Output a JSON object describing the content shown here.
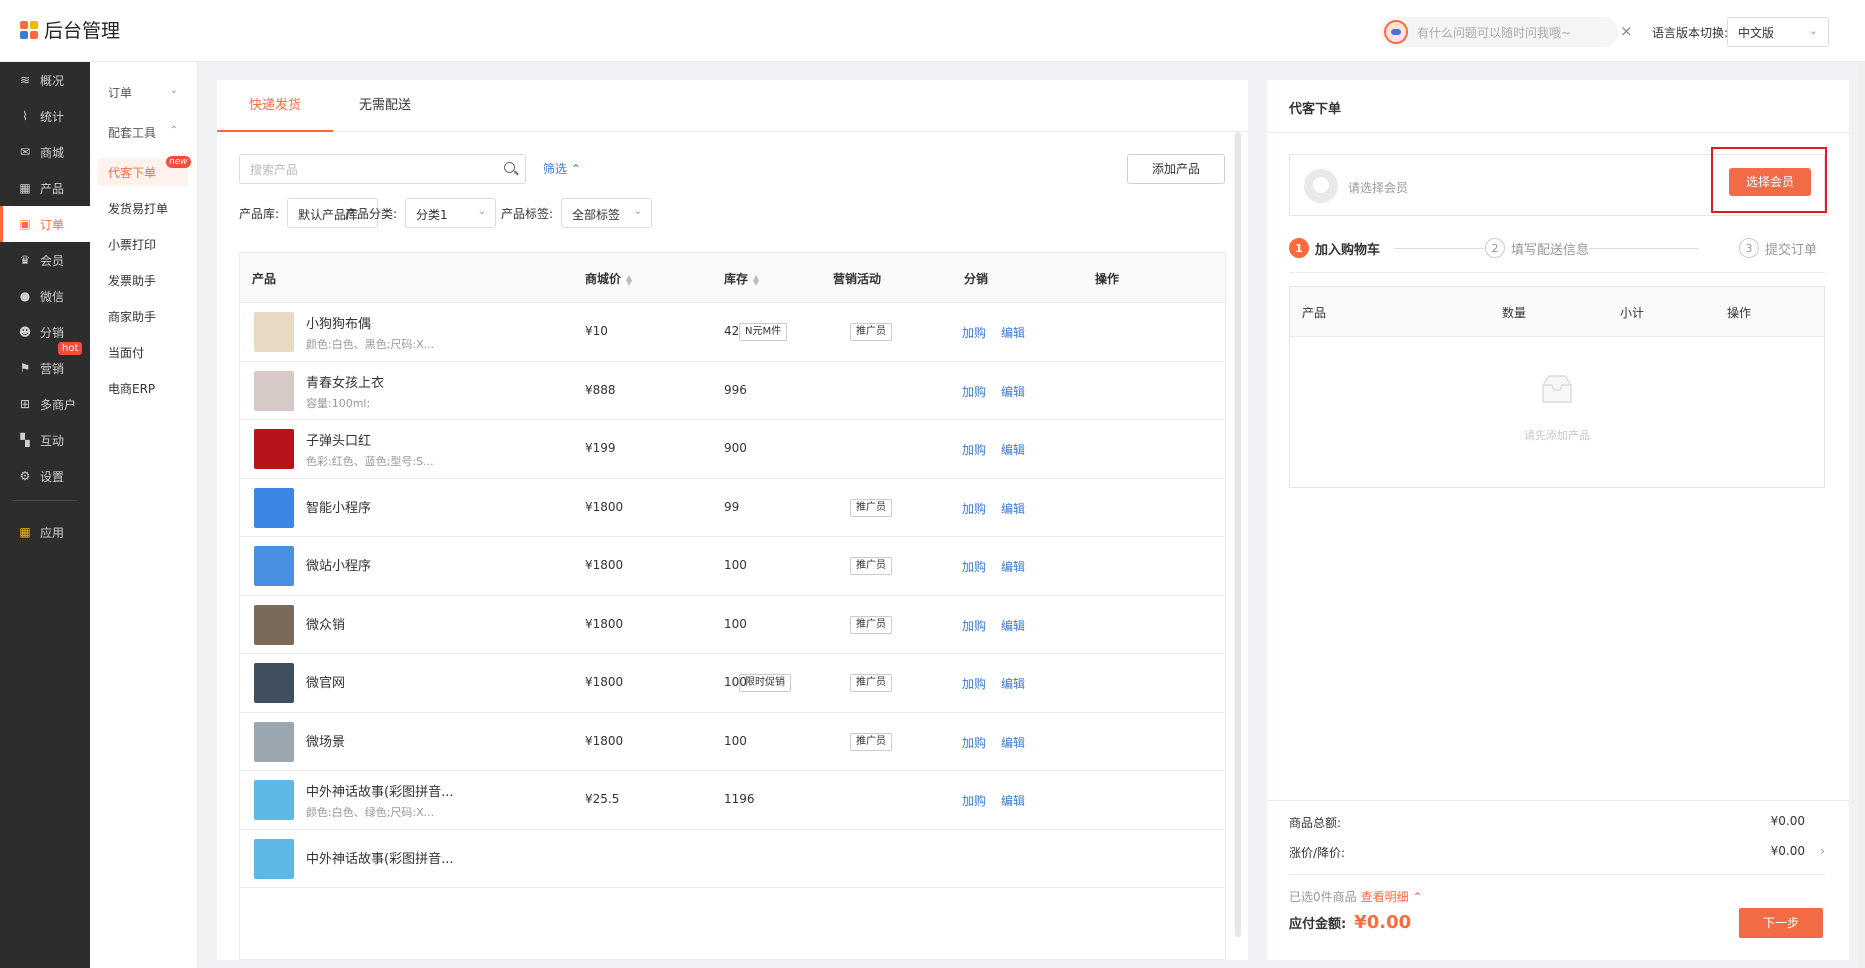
{
  "app": {
    "title": "后台管理",
    "logo_colors": [
      "#ff6a3d",
      "#f7b500",
      "#3a7bd5",
      "#ff6a3d"
    ]
  },
  "header": {
    "assistant_placeholder": "有什么问题可以随时问我哦~",
    "close": "×",
    "lang_label": "语言版本切换:",
    "lang_value": "中文版"
  },
  "sidebar": {
    "items": [
      {
        "label": "概况",
        "icon": "layers-icon"
      },
      {
        "label": "统计",
        "icon": "chart-icon"
      },
      {
        "label": "商城",
        "icon": "mail-icon"
      },
      {
        "label": "产品",
        "icon": "grid-icon"
      },
      {
        "label": "订单",
        "icon": "clipboard-icon"
      },
      {
        "label": "会员",
        "icon": "crown-icon"
      },
      {
        "label": "微信",
        "icon": "wechat-icon"
      },
      {
        "label": "分销",
        "icon": "people-icon"
      },
      {
        "label": "营销",
        "icon": "flag-icon",
        "badge": "hot"
      },
      {
        "label": "多商户",
        "icon": "store-icon"
      },
      {
        "label": "互动",
        "icon": "interact-icon"
      },
      {
        "label": "设置",
        "icon": "gear-icon"
      },
      {
        "label": "应用",
        "icon": "apps-icon"
      }
    ]
  },
  "subnav": {
    "group1": "订单",
    "group2": "配套工具",
    "items": [
      "代客下单",
      "发货易打单",
      "小票打印",
      "发票助手",
      "商家助手",
      "当面付",
      "电商ERP"
    ],
    "new_badge": "new"
  },
  "tabs": [
    "快递发货",
    "无需配送"
  ],
  "search": {
    "placeholder": "搜索产品",
    "filter_label": "筛选",
    "add_product": "添加产品"
  },
  "filters": {
    "library_label": "产品库:",
    "library_value": "默认产品库",
    "category_label": "产品分类:",
    "category_value": "分类1",
    "tag_label": "产品标签:",
    "tag_value": "全部标签"
  },
  "table": {
    "headers": {
      "product": "产品",
      "price": "商城价",
      "stock": "库存",
      "promo": "营销活动",
      "dist": "分销",
      "ops": "操作"
    },
    "op_add": "加购",
    "op_edit": "编辑",
    "rows": [
      {
        "name": "小狗狗布偶",
        "spec": "颜色:白色、黑色;尺码:X...",
        "price": "¥10",
        "stock": "42",
        "promo": "N元M件",
        "dist": "推广员",
        "thumb": "#e8d9c4"
      },
      {
        "name": "青春女孩上衣",
        "spec": "容量:100ml;",
        "price": "¥888",
        "stock": "996",
        "promo": "",
        "dist": "",
        "thumb": "#d7c9c6"
      },
      {
        "name": "子弹头口红",
        "spec": "色彩:红色、蓝色;型号:S...",
        "price": "¥199",
        "stock": "900",
        "promo": "",
        "dist": "",
        "thumb": "#b5151a"
      },
      {
        "name": "智能小程序",
        "spec": "",
        "price": "¥1800",
        "stock": "99",
        "promo": "",
        "dist": "推广员",
        "thumb": "#3a86e0"
      },
      {
        "name": "微站小程序",
        "spec": "",
        "price": "¥1800",
        "stock": "100",
        "promo": "",
        "dist": "推广员",
        "thumb": "#4a90e2"
      },
      {
        "name": "微众销",
        "spec": "",
        "price": "¥1800",
        "stock": "100",
        "promo": "",
        "dist": "推广员",
        "thumb": "#7a6a5a"
      },
      {
        "name": "微官网",
        "spec": "",
        "price": "¥1800",
        "stock": "100",
        "promo": "限时促销",
        "dist": "推广员",
        "thumb": "#3f4f5f"
      },
      {
        "name": "微场景",
        "spec": "",
        "price": "¥1800",
        "stock": "100",
        "promo": "",
        "dist": "推广员",
        "thumb": "#9aa6b0"
      },
      {
        "name": "中外神话故事(彩图拼音...",
        "spec": "颜色:白色、绿色;尺码:X...",
        "price": "¥25.5",
        "stock": "1196",
        "promo": "",
        "dist": "",
        "thumb": "#5cb8e6"
      },
      {
        "name": "中外神话故事(彩图拼音...",
        "spec": "",
        "price": "",
        "stock": "",
        "promo": "",
        "dist": "",
        "thumb": "#5cb8e6"
      }
    ]
  },
  "right": {
    "title": "代客下单",
    "member_placeholder": "请选择会员",
    "select_member": "选择会员",
    "steps": [
      "加入购物车",
      "填写配送信息",
      "提交订单"
    ],
    "step_nums": [
      "1",
      "2",
      "3"
    ],
    "cart_headers": {
      "product": "产品",
      "qty": "数量",
      "subtotal": "小计",
      "ops": "操作"
    },
    "empty_text": "请先添加产品",
    "goods_total_label": "商品总额:",
    "goods_total_value": "¥0.00",
    "adjust_label": "涨价/降价:",
    "adjust_value": "¥0.00",
    "selected_text": "已选0件商品",
    "detail_link": "查看明细",
    "payable_label": "应付金额:",
    "payable_value": "¥0.00",
    "next": "下一步"
  }
}
